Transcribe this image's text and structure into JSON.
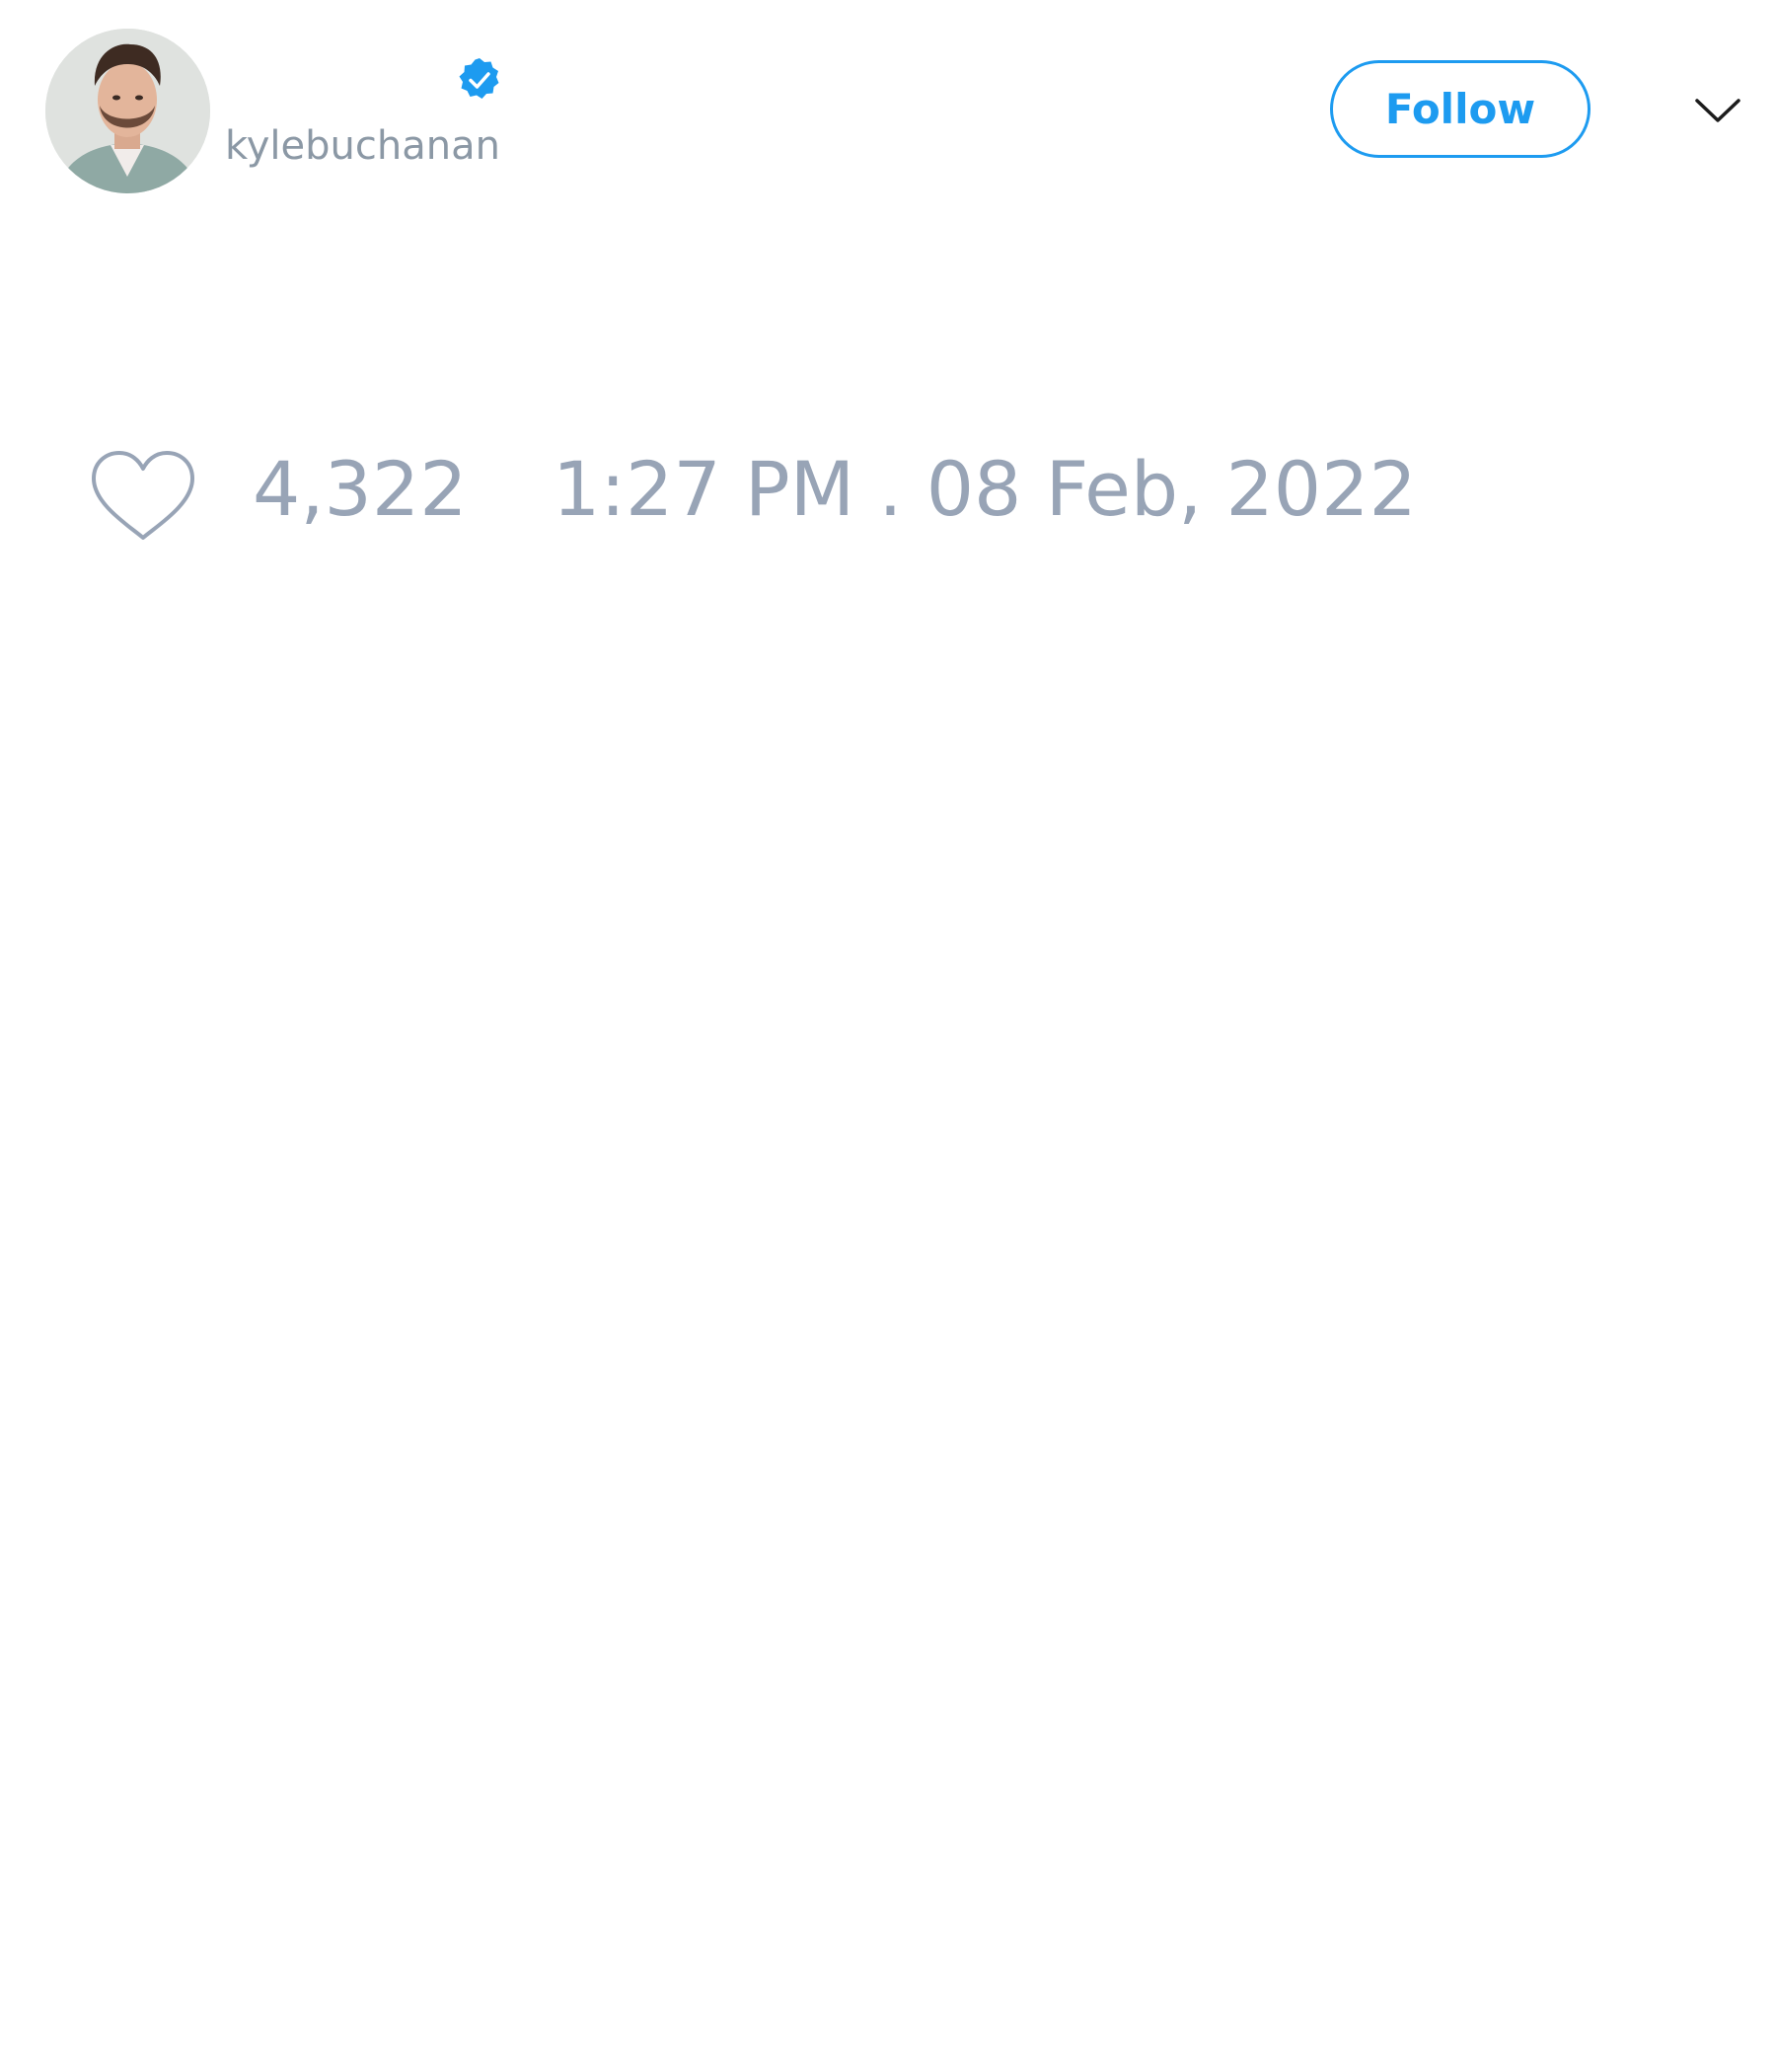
{
  "tweet": {
    "author": {
      "handle": "kylebuchanan",
      "verified": true,
      "avatar_icon": "profile-photo",
      "verified_icon": "verified-badge-icon",
      "verified_color": "#1d9bf0"
    },
    "follow_button": {
      "label": "Follow",
      "color": "#1d9bf0"
    },
    "menu_icon": "chevron-down-icon",
    "likes": {
      "icon": "heart-icon",
      "count": "4,322"
    },
    "timestamp": "1:27 PM . 08 Feb, 2022",
    "meta_color": "#98a4b6"
  }
}
